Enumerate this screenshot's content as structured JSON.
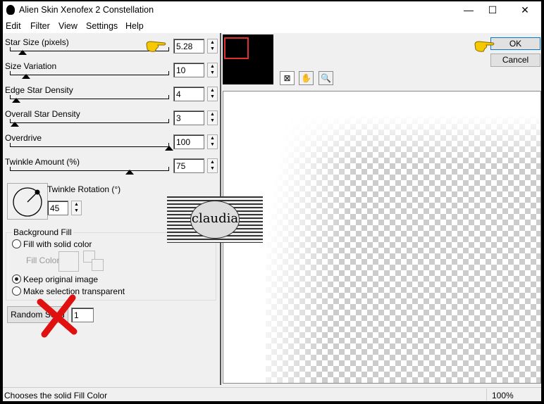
{
  "window": {
    "title": "Alien Skin Xenofex 2 Constellation",
    "minimize": "—",
    "maximize": "☐",
    "close": "✕"
  },
  "menu": [
    "Edit",
    "Filter",
    "View",
    "Settings",
    "Help"
  ],
  "params": [
    {
      "label": "Star Size (pixels)",
      "value": "5.28",
      "level": 0.08
    },
    {
      "label": "Size Variation",
      "value": "10",
      "level": 0.1
    },
    {
      "label": "Edge Star Density",
      "value": "4",
      "level": 0.04
    },
    {
      "label": "Overall Star Density",
      "value": "3",
      "level": 0.03
    },
    {
      "label": "Overdrive",
      "value": "100",
      "level": 1.0
    },
    {
      "label": "Twinkle Amount (%)",
      "value": "75",
      "level": 0.75
    }
  ],
  "rotation": {
    "label": "Twinkle Rotation (°)",
    "value": "45"
  },
  "background_fill": {
    "title": "Background Fill",
    "options": [
      "Fill with solid color",
      "Keep original image",
      "Make selection transparent"
    ],
    "selected": "Keep original image",
    "fill_color_label": "Fill Color"
  },
  "random_seed": {
    "label": "Random Seed",
    "value": "1"
  },
  "buttons": {
    "ok": "OK",
    "cancel": "Cancel"
  },
  "tools": [
    "navigate-icon",
    "hand-icon",
    "zoom-icon"
  ],
  "watermark": "claudia",
  "status": {
    "text": "Chooses the solid Fill Color",
    "zoom": "100%"
  },
  "colors": {
    "pointer_hand": "#f5c800",
    "cross": "#e01010",
    "thumb_rect": "#e03030"
  }
}
